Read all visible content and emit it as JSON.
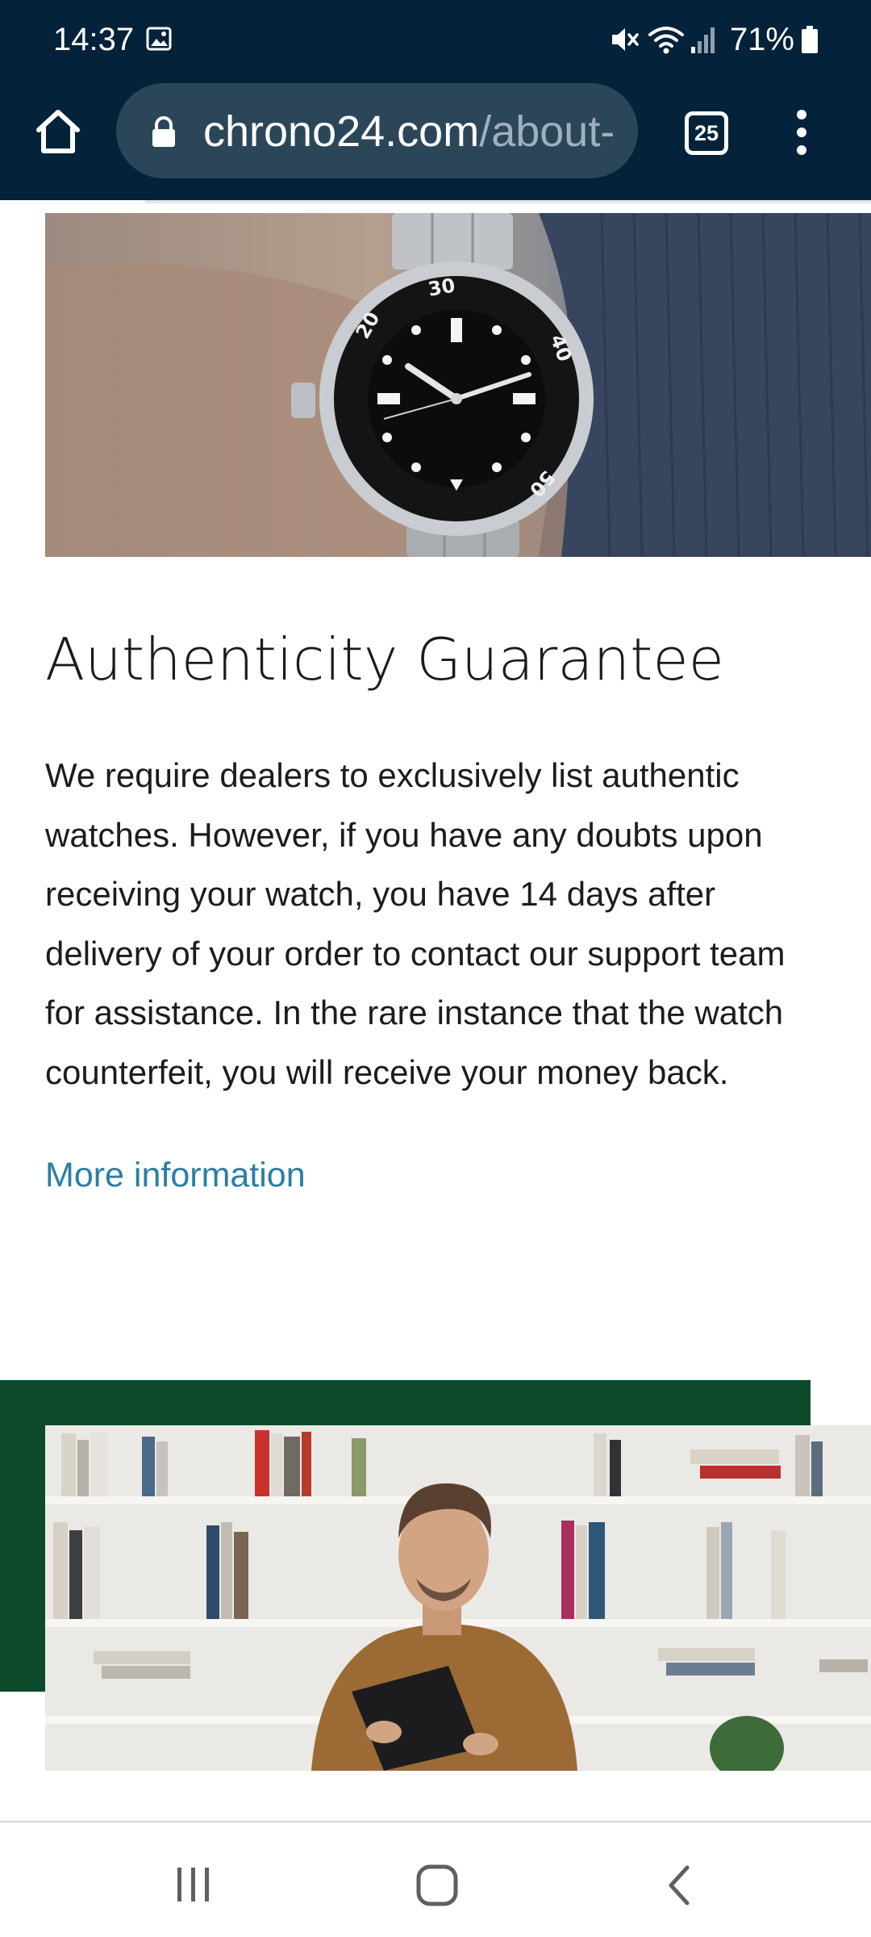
{
  "status_bar": {
    "time": "14:37",
    "battery": "71%",
    "icons": [
      "gallery-icon",
      "mute-icon",
      "wifi-icon",
      "signal-icon",
      "battery-icon"
    ]
  },
  "browser": {
    "url_domain": "chrono24.com",
    "url_path": "/about-",
    "tab_count": "25",
    "icons": [
      "home-icon",
      "lock-icon",
      "tab-switcher-icon",
      "more-menu-icon"
    ]
  },
  "section": {
    "title": "Authenticity Guarantee",
    "body_lines": [
      "We require dealers to exclusively list authentic",
      "watches. However, if you have any doubts upon",
      "receiving your watch, you have 14 days after",
      "delivery of your order to contact our support team",
      "for assistance. In the rare instance that the watch",
      "counterfeit, you will receive your money back."
    ],
    "link_label": "More information"
  },
  "watch_bezel_numbers": [
    "20",
    "30",
    "40",
    "50"
  ],
  "colors": {
    "header_bg": "#04223a",
    "url_bar_bg": "#2c4659",
    "link": "#2a7fa3",
    "accent_green": "#0d4a2c"
  },
  "nav_bar": {
    "icons": [
      "recent-apps-icon",
      "home-icon",
      "back-icon"
    ]
  }
}
